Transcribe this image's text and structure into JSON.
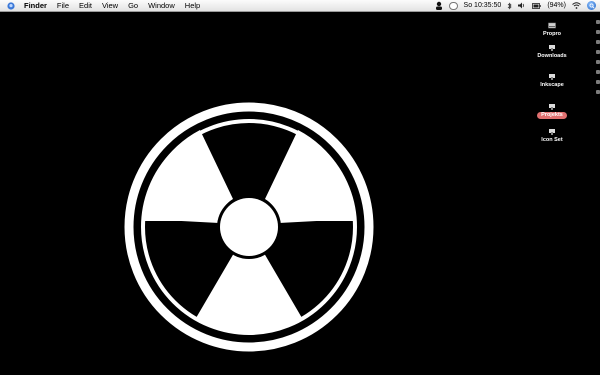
{
  "menubar": {
    "app": "Finder",
    "items": [
      "File",
      "Edit",
      "View",
      "Go",
      "Window",
      "Help"
    ],
    "clock": "So 10:35:50",
    "battery": "(94%)"
  },
  "desktop": {
    "icons": [
      {
        "label": "Propro",
        "icon": "drive-icon"
      },
      {
        "label": "Downloads",
        "icon": "folder-icon"
      },
      {
        "label": "Inkscape",
        "icon": "folder-icon"
      },
      {
        "label": "Projekts",
        "icon": "folder-icon",
        "selected": true
      },
      {
        "label": "Icon Set",
        "icon": "folder-icon"
      }
    ],
    "wallpaper": "radiation-symbol",
    "colors": {
      "background": "#000000",
      "symbol": "#ffffff",
      "selection": "#e07070"
    }
  }
}
